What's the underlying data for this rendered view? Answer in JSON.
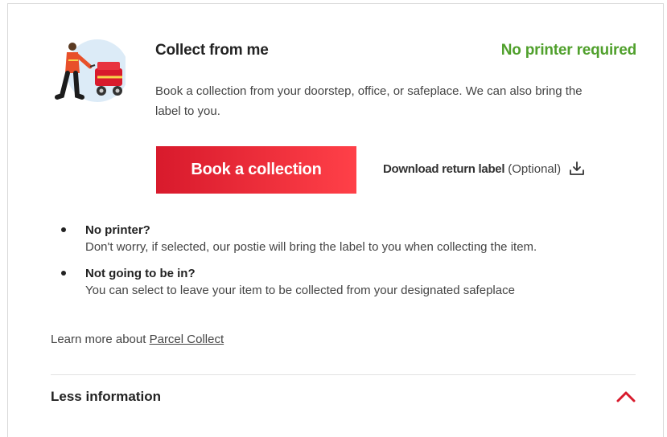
{
  "card": {
    "title": "Collect from me",
    "badge": "No printer required",
    "description": "Book a collection from your doorstep, office, or safeplace. We can also bring the label to you.",
    "primary_button": "Book a collection",
    "download": {
      "label": "Download return label",
      "optional": "(Optional)",
      "icon": "download-icon"
    }
  },
  "points": [
    {
      "title": "No printer?",
      "body": "Don't worry, if selected, our postie will bring the label to you when collecting the item."
    },
    {
      "title": "Not going to be in?",
      "body": "You can select to leave your item to be collected from your designated safeplace"
    }
  ],
  "learn_more": {
    "prefix": "Learn more about",
    "link": "Parcel Collect"
  },
  "toggle": {
    "label": "Less information",
    "icon": "chevron-up-icon"
  },
  "colors": {
    "brand_red": "#e21b2c",
    "badge_green": "#50a02c"
  }
}
